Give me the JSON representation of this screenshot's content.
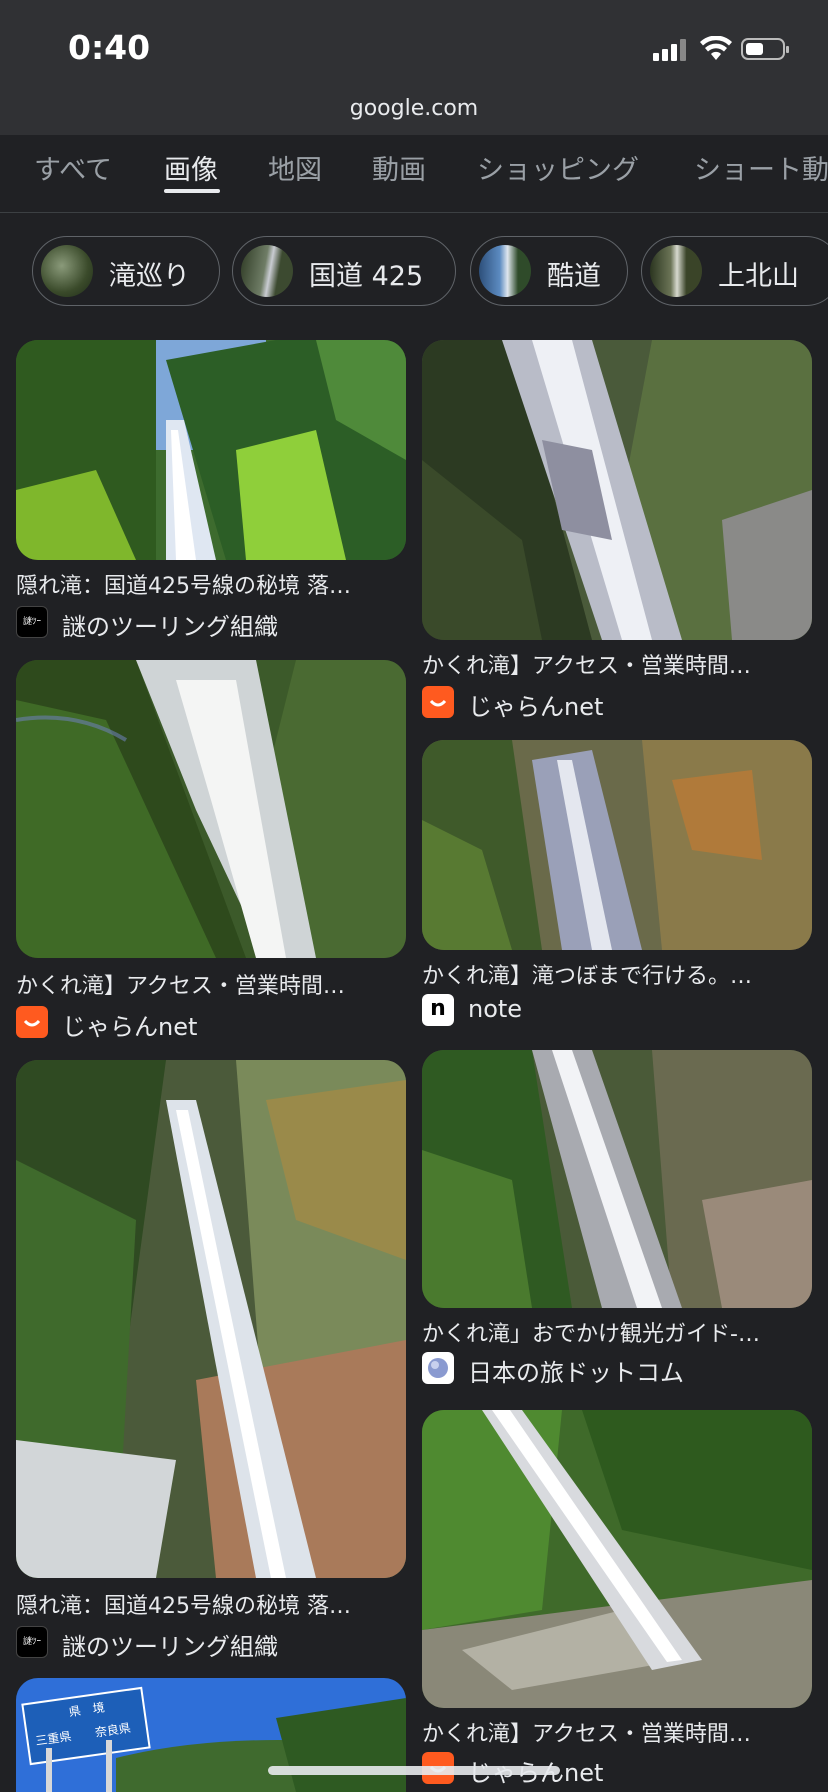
{
  "status_bar": {
    "time": "0:40"
  },
  "browser": {
    "url": "google.com"
  },
  "tabs": [
    {
      "label": "すべて"
    },
    {
      "label": "画像"
    },
    {
      "label": "地図"
    },
    {
      "label": "動画"
    },
    {
      "label": "ショッピング"
    },
    {
      "label": "ショート動画"
    }
  ],
  "chips": [
    {
      "label": "滝巡り"
    },
    {
      "label": "国道 425"
    },
    {
      "label": "酷道"
    },
    {
      "label": "上北山"
    }
  ],
  "results": [
    {
      "caption": "隠れ滝：国道425号線の秘境 落…",
      "source": "謎のツーリング組織"
    },
    {
      "caption": "かくれ滝】アクセス・営業時間…",
      "source": "じゃらんnet"
    },
    {
      "caption": "かくれ滝】アクセス・営業時間…",
      "source": "じゃらんnet"
    },
    {
      "caption": "かくれ滝】滝つぼまで行ける。…",
      "source": "note"
    },
    {
      "caption": "隠れ滝：国道425号線の秘境 落…",
      "source": "謎のツーリング組織"
    },
    {
      "caption": "かくれ滝」おでかけ観光ガイド-…",
      "source": "日本の旅ドットコム"
    },
    {
      "caption": "かくれ滝】アクセス・営業時間…",
      "source": "じゃらんnet"
    }
  ],
  "sign": {
    "top": "県　境",
    "left": "三重県",
    "right": "奈良県"
  },
  "favicons": {
    "touring": "謎ﾂｰ",
    "note": "n"
  },
  "colors": {
    "background": "#202124",
    "jalan": "#ff5a1f"
  }
}
